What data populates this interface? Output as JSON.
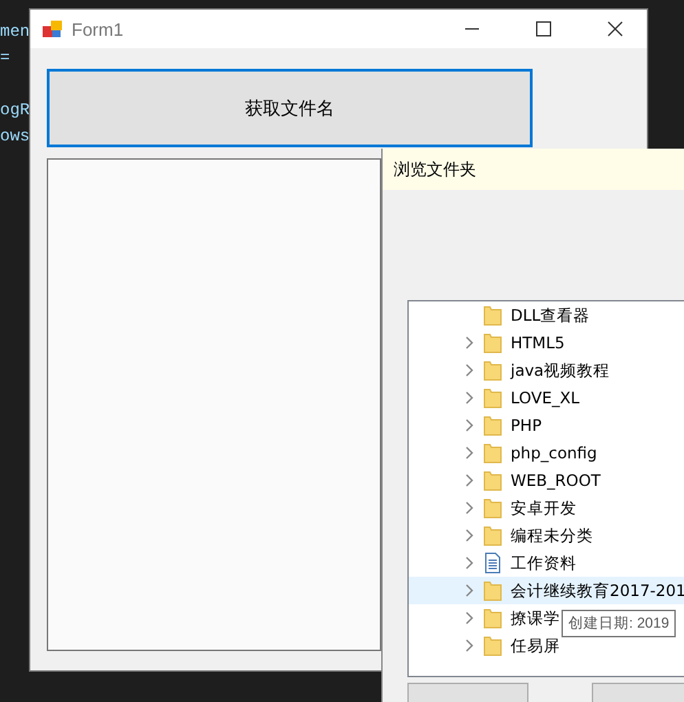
{
  "editor": {
    "lines": [
      "men",
      "=",
      "ogR",
      "ows"
    ]
  },
  "window": {
    "title": "Form1"
  },
  "get_filename_button": {
    "label": "获取文件名"
  },
  "dialog": {
    "title": "浏览文件夹",
    "tree": [
      {
        "label": "DLL查看器",
        "kind": "folder",
        "expandable": false,
        "selected": false
      },
      {
        "label": "HTML5",
        "kind": "folder",
        "expandable": true,
        "selected": false
      },
      {
        "label": "java视频教程",
        "kind": "folder",
        "expandable": true,
        "selected": false
      },
      {
        "label": "LOVE_XL",
        "kind": "folder",
        "expandable": true,
        "selected": false
      },
      {
        "label": "PHP",
        "kind": "folder",
        "expandable": true,
        "selected": false
      },
      {
        "label": "php_config",
        "kind": "folder",
        "expandable": true,
        "selected": false
      },
      {
        "label": "WEB_ROOT",
        "kind": "folder",
        "expandable": true,
        "selected": false
      },
      {
        "label": "安卓开发",
        "kind": "folder",
        "expandable": true,
        "selected": false
      },
      {
        "label": "编程未分类",
        "kind": "folder",
        "expandable": true,
        "selected": false
      },
      {
        "label": "工作资料",
        "kind": "document",
        "expandable": true,
        "selected": false
      },
      {
        "label": "会计继续教育2017-201",
        "kind": "folder",
        "expandable": true,
        "selected": true
      },
      {
        "label": "撩课学",
        "kind": "folder",
        "expandable": true,
        "selected": false
      },
      {
        "label": "任易屏",
        "kind": "folder",
        "expandable": true,
        "selected": false
      }
    ],
    "tooltip": "创建日期: 2019"
  }
}
